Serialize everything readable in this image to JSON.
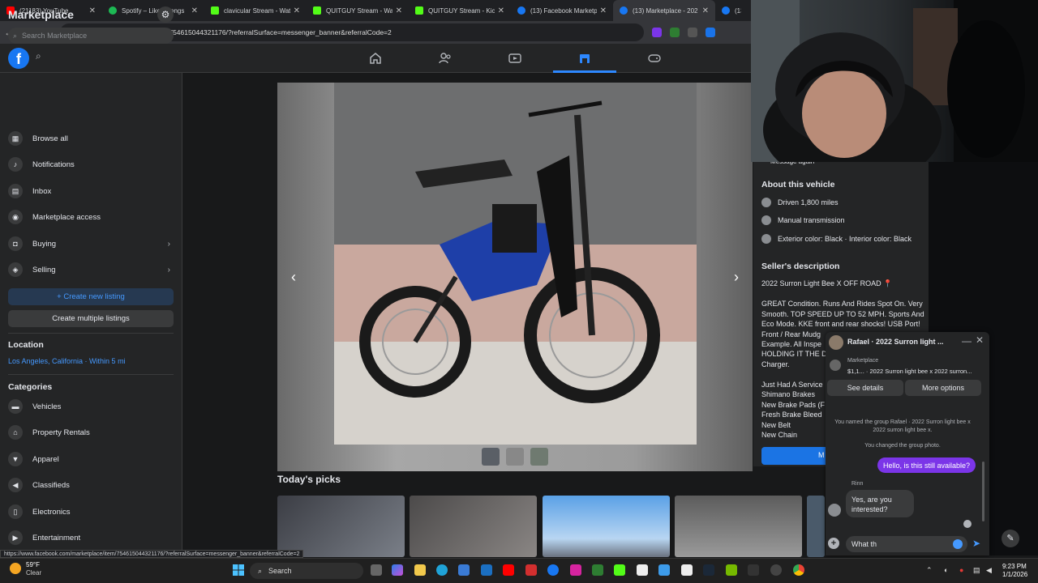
{
  "browser": {
    "tabs": [
      {
        "label": "(21183) YouTube",
        "color": "#ff0000"
      },
      {
        "label": "Spotify – Liked Songs",
        "color": "#1db954"
      },
      {
        "label": "clavicular Stream - Watc",
        "color": "#53fc18"
      },
      {
        "label": "QUITGUY Stream - Watc",
        "color": "#53fc18"
      },
      {
        "label": "QUITGUY Stream - Kick",
        "color": "#53fc18"
      },
      {
        "label": "(13) Facebook Marketpl",
        "color": "#1877f2"
      },
      {
        "label": "(13) Marketplace - 202",
        "color": "#1877f2"
      },
      {
        "label": "(13",
        "color": "#1877f2"
      }
    ],
    "url": "facebook.com/marketplace/item/754615044321176/?referralSurface=messenger_banner&referralCode=2",
    "status_url": "https://www.facebook.com/marketplace/item/754615044321176/?referralSurface=messenger_banner&referralCode=2"
  },
  "sidebar": {
    "title": "Marketplace",
    "search_placeholder": "Search Marketplace",
    "items": [
      {
        "label": "Browse all",
        "icon": "storefront-icon"
      },
      {
        "label": "Notifications",
        "icon": "bell-icon"
      },
      {
        "label": "Inbox",
        "icon": "inbox-icon"
      },
      {
        "label": "Marketplace access",
        "icon": "shield-icon"
      },
      {
        "label": "Buying",
        "icon": "bag-icon"
      },
      {
        "label": "Selling",
        "icon": "tag-icon"
      }
    ],
    "create_listing": "+ Create new listing",
    "create_multiple": "Create multiple listings",
    "location_heading": "Location",
    "location_value": "Los Angeles, California · Within 5 mi",
    "categories_heading": "Categories",
    "categories": [
      {
        "label": "Vehicles",
        "icon": "car-icon"
      },
      {
        "label": "Property Rentals",
        "icon": "house-icon"
      },
      {
        "label": "Apparel",
        "icon": "shirt-icon"
      },
      {
        "label": "Classifieds",
        "icon": "megaphone-icon"
      },
      {
        "label": "Electronics",
        "icon": "phone-icon"
      },
      {
        "label": "Entertainment",
        "icon": "film-icon"
      }
    ]
  },
  "main": {
    "todays_picks": "Today's picks"
  },
  "detail": {
    "top_button": "Message again",
    "about_heading": "About this vehicle",
    "about_rows": [
      "Driven 1,800 miles",
      "Manual transmission",
      "Exterior color: Black · Interior color: Black"
    ],
    "seller_heading": "Seller's description",
    "title_line": "2022 Surron Light Bee X OFF ROAD 📍",
    "desc_para1": "GREAT Condition. Runs And Rides Spot On. Very Smooth. TOP SPEED UP TO 52 MPH. Sports And Eco Mode. KKE front and rear shocks! USB Port! Front / Rear Mudg",
    "desc_partial": [
      "Example. All Inspe",
      "HOLDING IT THE D",
      "Charger."
    ],
    "service_lines": [
      "Just Had A Service",
      "Shimano Brakes",
      "New Brake Pads (F",
      "Fresh Brake Bleed",
      "New Belt",
      "New Chain"
    ],
    "msg_btn_fragment": "M"
  },
  "chat": {
    "title": "Rafael · 2022 Surron light ...",
    "marketplace_label": "Marketplace",
    "item_line": "$1,1... · 2022 Surron light bee x 2022 surron...",
    "see_details": "See details",
    "more_options": "More options",
    "system1": "You named the group Rafael · 2022 Surron light bee x 2022 surron light bee x.",
    "system2": "You changed the group photo.",
    "outgoing": "Hello, is this still available?",
    "sender": "Rinn",
    "incoming": "Yes, are you interested?",
    "input_value": "What th"
  },
  "taskbar": {
    "temp": "59°F",
    "weather": "Clear",
    "search": "Search",
    "time": "9:23 PM",
    "date": "1/1/2026"
  }
}
